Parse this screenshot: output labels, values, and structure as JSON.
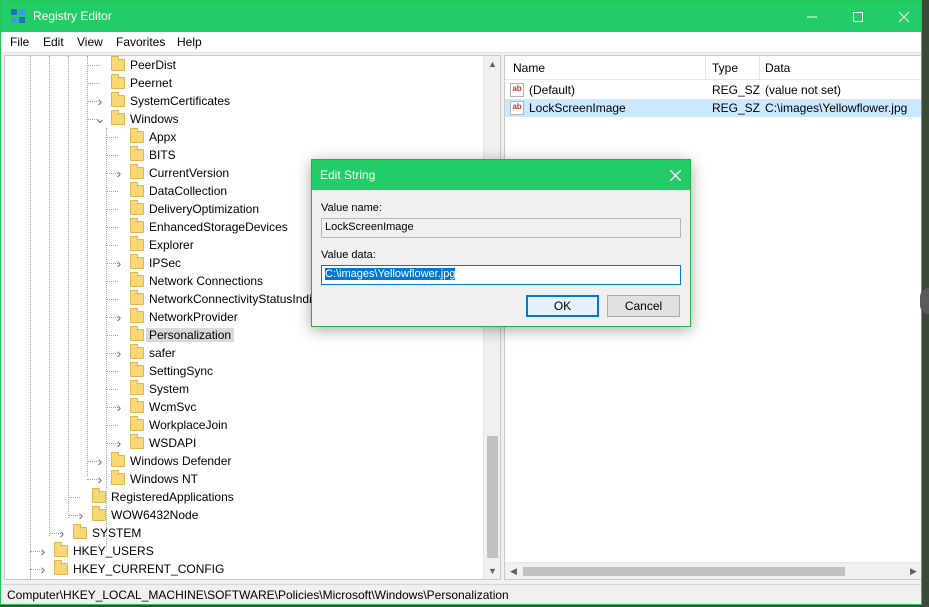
{
  "window": {
    "title": "Registry Editor",
    "icon": "registry-editor-icon",
    "accent_color": "#22cc66"
  },
  "menu": [
    "File",
    "Edit",
    "View",
    "Favorites",
    "Help"
  ],
  "tree": {
    "items": [
      {
        "label": "PeerDist",
        "expander": ""
      },
      {
        "label": "Peernet",
        "expander": ""
      },
      {
        "label": "SystemCertificates",
        "expander": "collapsed"
      },
      {
        "label": "Windows",
        "expander": "expanded"
      },
      {
        "label": "Appx",
        "expander": ""
      },
      {
        "label": "BITS",
        "expander": ""
      },
      {
        "label": "CurrentVersion",
        "expander": "collapsed"
      },
      {
        "label": "DataCollection",
        "expander": ""
      },
      {
        "label": "DeliveryOptimization",
        "expander": ""
      },
      {
        "label": "EnhancedStorageDevices",
        "expander": ""
      },
      {
        "label": "Explorer",
        "expander": ""
      },
      {
        "label": "IPSec",
        "expander": "collapsed"
      },
      {
        "label": "Network Connections",
        "expander": ""
      },
      {
        "label": "NetworkConnectivityStatusIndicator",
        "expander": ""
      },
      {
        "label": "NetworkProvider",
        "expander": "collapsed"
      },
      {
        "label": "Personalization",
        "expander": "",
        "selected": true
      },
      {
        "label": "safer",
        "expander": "collapsed"
      },
      {
        "label": "SettingSync",
        "expander": ""
      },
      {
        "label": "System",
        "expander": ""
      },
      {
        "label": "WcmSvc",
        "expander": "collapsed"
      },
      {
        "label": "WorkplaceJoin",
        "expander": ""
      },
      {
        "label": "WSDAPI",
        "expander": "collapsed"
      },
      {
        "label": "Windows Defender",
        "expander": "collapsed"
      },
      {
        "label": "Windows NT",
        "expander": "collapsed"
      },
      {
        "label": "RegisteredApplications",
        "expander": ""
      },
      {
        "label": "WOW6432Node",
        "expander": "collapsed"
      },
      {
        "label": "SYSTEM",
        "expander": "collapsed"
      },
      {
        "label": "HKEY_USERS",
        "expander": "collapsed"
      },
      {
        "label": "HKEY_CURRENT_CONFIG",
        "expander": "collapsed"
      }
    ]
  },
  "values": {
    "columns": [
      "Name",
      "Type",
      "Data"
    ],
    "rows": [
      {
        "name": "(Default)",
        "type": "REG_SZ",
        "data": "(value not set)"
      },
      {
        "name": "LockScreenImage",
        "type": "REG_SZ",
        "data": "C:\\images\\Yellowflower.jpg",
        "selected": true
      }
    ]
  },
  "status": {
    "path": "Computer\\HKEY_LOCAL_MACHINE\\SOFTWARE\\Policies\\Microsoft\\Windows\\Personalization"
  },
  "dialog": {
    "title": "Edit String",
    "value_name_label": "Value name:",
    "value_name": "LockScreenImage",
    "value_data_label": "Value data:",
    "value_data": "C:\\images\\Yellowflower.jpg",
    "ok_label": "OK",
    "cancel_label": "Cancel"
  }
}
